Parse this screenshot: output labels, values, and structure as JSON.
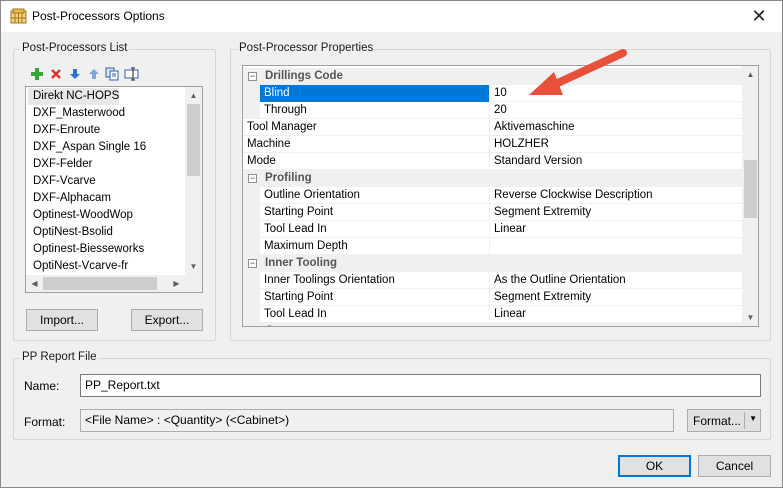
{
  "window": {
    "title": "Post-Processors Options",
    "close_glyph": "✕"
  },
  "left_panel": {
    "title": "Post-Processors List",
    "toolbar": [
      {
        "icon": "add-icon"
      },
      {
        "icon": "delete-icon"
      },
      {
        "icon": "move-down-icon"
      },
      {
        "icon": "move-up-icon"
      },
      {
        "icon": "copy-icon"
      },
      {
        "icon": "rename-icon"
      }
    ],
    "items": [
      "Direkt NC-HOPS",
      "DXF_Masterwood",
      "DXF-Enroute",
      "DXF_Aspan Single 16",
      "DXF-Felder",
      "DXF-Vcarve",
      "DXF-Alphacam",
      "Optinest-WoodWop",
      "OptiNest-Bsolid",
      "Optinest-Biesseworks",
      "OptiNest-Vcarve-fr"
    ],
    "selected_index": 0,
    "import_label": "Import...",
    "export_label": "Export..."
  },
  "right_panel": {
    "title": "Post-Processor Properties",
    "rows": [
      {
        "kind": "category",
        "name": "Drillings Code",
        "expander": "−"
      },
      {
        "kind": "prop",
        "indent": true,
        "name": "Blind",
        "value": "10",
        "selected": true
      },
      {
        "kind": "prop",
        "indent": true,
        "name": "Through",
        "value": "20"
      },
      {
        "kind": "prop",
        "indent": false,
        "name": "Tool Manager",
        "value": "Aktivemaschine"
      },
      {
        "kind": "prop",
        "indent": false,
        "name": "Machine",
        "value": "HOLZHER"
      },
      {
        "kind": "prop",
        "indent": false,
        "name": "Mode",
        "value": "Standard Version"
      },
      {
        "kind": "category",
        "name": "Profiling",
        "expander": "−"
      },
      {
        "kind": "prop",
        "indent": true,
        "name": "Outline Orientation",
        "value": "Reverse Clockwise Description"
      },
      {
        "kind": "prop",
        "indent": true,
        "name": "Starting Point",
        "value": "Segment Extremity"
      },
      {
        "kind": "prop",
        "indent": true,
        "name": "Tool Lead In",
        "value": "Linear"
      },
      {
        "kind": "prop",
        "indent": true,
        "name": "Maximum Depth",
        "value": ""
      },
      {
        "kind": "category",
        "name": "Inner Tooling",
        "expander": "−"
      },
      {
        "kind": "prop",
        "indent": true,
        "name": "Inner Toolings Orientation",
        "value": "As the Outline Orientation"
      },
      {
        "kind": "prop",
        "indent": true,
        "name": "Starting Point",
        "value": "Segment Extremity"
      },
      {
        "kind": "prop",
        "indent": true,
        "name": "Tool Lead In",
        "value": "Linear"
      },
      {
        "kind": "category",
        "name": "Grooves",
        "expander": "−"
      }
    ]
  },
  "report": {
    "title": "PP Report File",
    "name_label": "Name:",
    "name_value": "PP_Report.txt",
    "format_label": "Format:",
    "format_value": "<File Name> : <Quantity> (<Cabinet>)",
    "format_button_label": "Format...",
    "format_dropdown_glyph": "▼"
  },
  "footer": {
    "ok_label": "OK",
    "cancel_label": "Cancel"
  },
  "colors": {
    "selection": "#0078d7",
    "annotation_arrow": "#e8503a"
  }
}
